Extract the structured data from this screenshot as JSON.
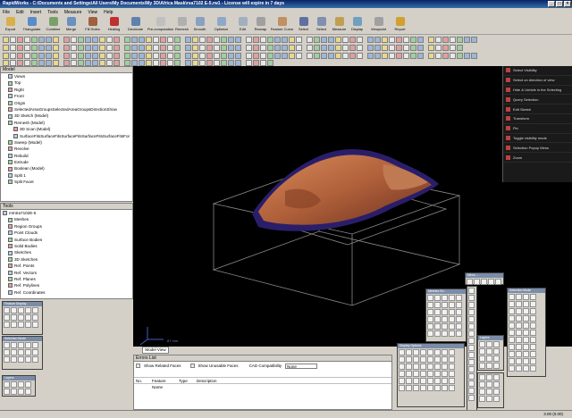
{
  "window": {
    "title": "RapidWorks - C:\\Documents and Settings\\All Users\\My Documents\\My 3D\\Africa Mask\\rsa7102 E-5.rw1 - License will expire in 7 days"
  },
  "menu": [
    "File",
    "Edit",
    "Insert",
    "Tools",
    "Measure",
    "View",
    "Help"
  ],
  "big_tools": [
    {
      "label": "Export",
      "color": "#d9b04a"
    },
    {
      "label": "Triangulate",
      "color": "#5a8cc8"
    },
    {
      "label": "Combine",
      "color": "#7aa06a"
    },
    {
      "label": "Merge",
      "color": "#6a90c0"
    },
    {
      "label": "Fill Holes",
      "color": "#a06040"
    },
    {
      "label": "Healing",
      "color": "#c03030"
    },
    {
      "label": "Decimate",
      "color": "#6080b0"
    },
    {
      "label": "Pre-computation",
      "color": "#c0c0c0"
    },
    {
      "label": "Remesh",
      "color": "#b0b0b0"
    },
    {
      "label": "Smooth",
      "color": "#8aa0c0"
    },
    {
      "label": "Optimize",
      "color": "#90a8c8"
    },
    {
      "label": "Edit",
      "color": "#a0b0c0"
    },
    {
      "label": "Rewrap",
      "color": "#a0a0a0"
    },
    {
      "label": "Feature Curve",
      "color": "#c09060"
    },
    {
      "label": "Select",
      "color": "#6070a0"
    },
    {
      "label": "Select",
      "color": "#8090b0"
    },
    {
      "label": "Measure",
      "color": "#c0a050"
    },
    {
      "label": "Display",
      "color": "#70a0c0"
    },
    {
      "label": "Viewpoint",
      "color": "#a0a0a0"
    },
    {
      "label": "Report",
      "color": "#d0a030"
    }
  ],
  "model_tree": {
    "title": "Model",
    "items": [
      {
        "label": "Views",
        "indent": 1
      },
      {
        "label": "Top",
        "indent": 1
      },
      {
        "label": "Right",
        "indent": 1
      },
      {
        "label": "Front",
        "indent": 1
      },
      {
        "label": "Origin",
        "indent": 1
      },
      {
        "label": "SelectedAreaGroupsSelectedAreaGroupsDirectionShow",
        "indent": 1
      },
      {
        "label": "3D Sketch (Model)",
        "indent": 1
      },
      {
        "label": "Remesh (Model)",
        "indent": 1
      },
      {
        "label": "3D Scan (Model)",
        "indent": 2
      },
      {
        "label": "SurfaceFitsSurfaceFitsSurfaceFitsSurfaceFitsSurfaceFitsFor",
        "indent": 2
      },
      {
        "label": "Sweep (Model)",
        "indent": 1
      },
      {
        "label": "Revolve",
        "indent": 1
      },
      {
        "label": "Rebuild",
        "indent": 1
      },
      {
        "label": "Extrude",
        "indent": 1
      },
      {
        "label": "Boolean (Model)",
        "indent": 1
      },
      {
        "label": "Split 1",
        "indent": 1
      },
      {
        "label": "Split Facet",
        "indent": 1
      }
    ]
  },
  "feature_tree": {
    "title": "Tools",
    "items": [
      {
        "label": "mIntra7102E-5",
        "indent": 0
      },
      {
        "label": "Meshes",
        "indent": 1
      },
      {
        "label": "Region Groups",
        "indent": 1
      },
      {
        "label": "Point Clouds",
        "indent": 1
      },
      {
        "label": "Surface Bodies",
        "indent": 1
      },
      {
        "label": "Solid Bodies",
        "indent": 1
      },
      {
        "label": "Sketches",
        "indent": 1
      },
      {
        "label": "3D Sketches",
        "indent": 1
      },
      {
        "label": "Ref. Points",
        "indent": 1
      },
      {
        "label": "Ref. Vectors",
        "indent": 1
      },
      {
        "label": "Ref. Planes",
        "indent": 1
      },
      {
        "label": "Ref. Polylines",
        "indent": 1
      },
      {
        "label": "Ref. Coordinates",
        "indent": 1
      }
    ]
  },
  "context_menu": [
    "Select Visibility",
    "Select on direction of view",
    "Hide & Unhide in the Selecting",
    "Query Selection",
    "Edit Sketch",
    "Transform",
    "Pin",
    "Toggle visibility mode",
    "Selection Popup Menu",
    "Zoom"
  ],
  "view_tab": "Model View",
  "axis_label": "87 mm",
  "error_panel": {
    "title": "Errors List",
    "show_related": "Show Related Faces",
    "show_unusable": "Show Unusable Faces",
    "cad_label": "CAD Compatibility",
    "cad_value": "None",
    "columns": [
      "No.",
      "Feature Name",
      "Type",
      "Description"
    ]
  },
  "float_titles": [
    "Feature Display",
    "Selection Mode",
    "Layers",
    "Meshes Ed..",
    "Display Options",
    "Menu ..."
  ],
  "status": {
    "left": "",
    "right": "3.00 (0.00)"
  },
  "colors": {
    "mesh": "#b0603a",
    "mesh_dark": "#2a1e6a",
    "viewport": "#000000"
  }
}
